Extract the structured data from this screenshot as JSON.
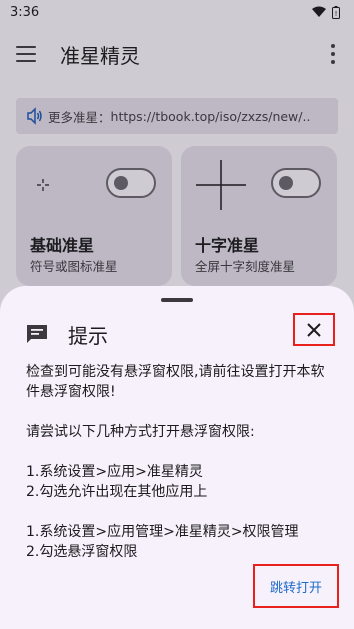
{
  "status_bar": {
    "time": "3:36"
  },
  "app_bar": {
    "title": "准星精灵"
  },
  "more_link": {
    "prefix": "更多准星：",
    "url": "https://tbook.top/iso/zxzs/new/.."
  },
  "cards": [
    {
      "title": "基础准星",
      "subtitle": "符号或图标准星",
      "toggle": "off"
    },
    {
      "title": "十字准星",
      "subtitle": "全屏十字刻度准星",
      "toggle": "off"
    }
  ],
  "dialog": {
    "title": "提示",
    "message_lines": [
      "检查到可能没有悬浮窗权限,请前往设置打开本软件悬浮窗权限!",
      "请尝试以下几种方式打开悬浮窗权限:",
      "1.系统设置>应用>准星精灵",
      "2.勾选允许出现在其他应用上",
      "1.系统设置>应用管理>准星精灵>权限管理",
      "2.勾选悬浮窗权限"
    ],
    "confirm_label": "跳转打开"
  },
  "colors": {
    "highlight_border": "#e8211c",
    "link": "#1d6ac9",
    "sheet_bg": "#f6f1fa",
    "scrim_bg": "#cfcbd3"
  }
}
